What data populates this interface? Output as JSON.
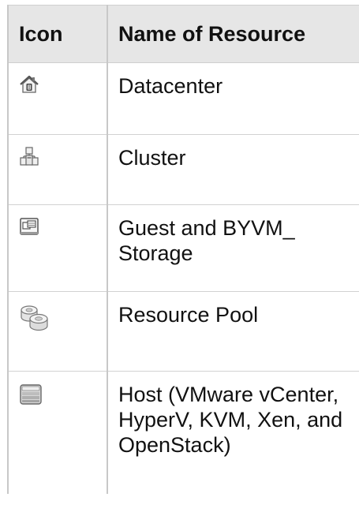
{
  "table": {
    "headers": {
      "icon": "Icon",
      "name": "Name of Resource"
    },
    "rows": [
      {
        "icon": "datacenter-icon",
        "name": "Datacenter"
      },
      {
        "icon": "cluster-icon",
        "name": "Cluster"
      },
      {
        "icon": "guest-icon",
        "name": "Guest and BYVM_ Storage"
      },
      {
        "icon": "resource-pool-icon",
        "name": "Resource Pool"
      },
      {
        "icon": "host-icon",
        "name": "Host (VMware vCenter, HyperV, KVM, Xen, and OpenStack)"
      }
    ]
  },
  "colors": {
    "header_background": "#e6e6e6",
    "grid_lines": "#c8c8c8",
    "text": "#111111"
  }
}
